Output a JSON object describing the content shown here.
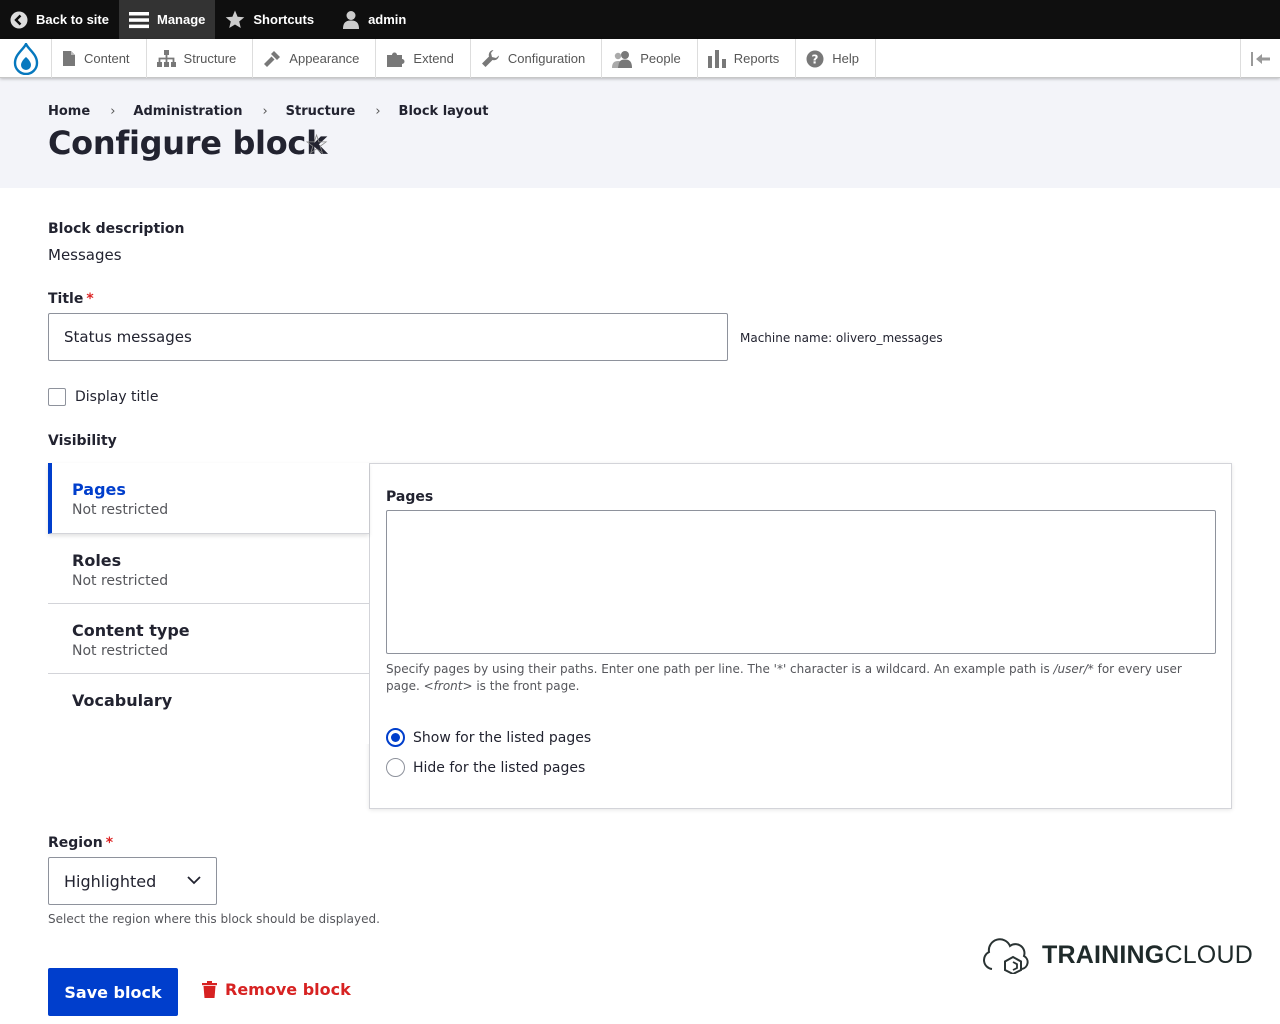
{
  "toolbar": {
    "back_to_site": "Back to site",
    "manage": "Manage",
    "shortcuts": "Shortcuts",
    "user": "admin"
  },
  "tray": {
    "items": [
      "Content",
      "Structure",
      "Appearance",
      "Extend",
      "Configuration",
      "People",
      "Reports",
      "Help"
    ]
  },
  "breadcrumb": [
    "Home",
    "Administration",
    "Structure",
    "Block layout"
  ],
  "page_title": "Configure block",
  "form": {
    "block_description_label": "Block description",
    "block_description_value": "Messages",
    "title_label": "Title",
    "required_mark": "*",
    "title_value": "Status messages",
    "machine_name": "Machine name: olivero_messages",
    "display_title_label": "Display title",
    "visibility_label": "Visibility",
    "tabs": [
      {
        "title": "Pages",
        "summary": "Not restricted"
      },
      {
        "title": "Roles",
        "summary": "Not restricted"
      },
      {
        "title": "Content type",
        "summary": "Not restricted"
      },
      {
        "title": "Vocabulary",
        "summary": ""
      }
    ],
    "pages_label": "Pages",
    "pages_desc_1": "Specify pages by using their paths. Enter one path per line. The '*' character is a wildcard. An example path is ",
    "pages_desc_path": "/user/*",
    "pages_desc_2": " for every user page. ",
    "pages_desc_front": "<front>",
    "pages_desc_3": " is the front page.",
    "radio_show": "Show for the listed pages",
    "radio_hide": "Hide for the listed pages",
    "region_label": "Region",
    "region_value": "Highlighted",
    "region_desc": "Select the region where this block should be displayed.",
    "save_button": "Save block",
    "remove_button": "Remove block"
  },
  "watermark": {
    "bold": "TRAINING",
    "light": "CLOUD"
  },
  "colors": {
    "accent": "#003ecc",
    "danger": "#d72222",
    "required": "#dc2323"
  }
}
